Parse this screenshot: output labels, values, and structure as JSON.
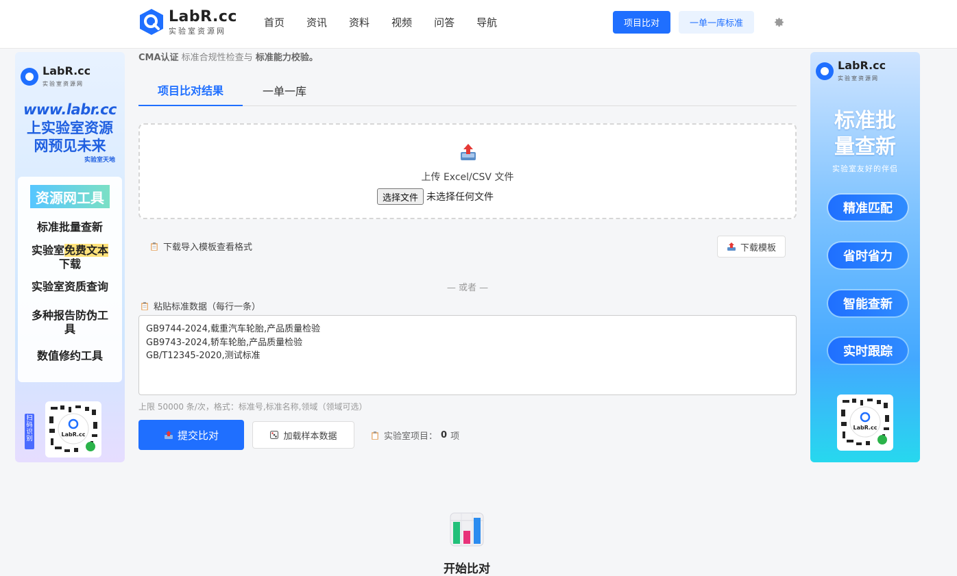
{
  "header": {
    "logo_main": "LabR.cc",
    "logo_sub": "实验室资源网",
    "nav": [
      "首页",
      "资讯",
      "资料",
      "视频",
      "问答",
      "导航"
    ],
    "btn_compare": "项目比对",
    "btn_standard": "一单一库标准"
  },
  "left_ad": {
    "logo_main": "LabR.cc",
    "logo_sub": "实验室资源网",
    "url": "www.labr.cc",
    "slogan_1": "上实验室资源",
    "slogan_2": "网预见未来",
    "tag": "实验室天地",
    "tools_title": "资源网工具",
    "tools": [
      "标准批量查新",
      "实验室",
      "免费文本",
      "下载",
      "实验室资质查询",
      "多种报告防伪工",
      "具",
      "数值修约工具"
    ],
    "scan_tag": "扫码识别",
    "qr_label": "LabR.cc"
  },
  "right_ad": {
    "logo_main": "LabR.cc",
    "logo_sub": "实验室资源网",
    "title_1": "标准批",
    "title_2": "量查新",
    "subtitle": "实验室友好的伴侣",
    "pills": [
      "精准匹配",
      "省时省力",
      "智能查新",
      "实时跟踪"
    ],
    "qr_label": "LabR.cc"
  },
  "main": {
    "crumb_1": "CMA认证",
    "crumb_2": " 标准合规性检查与 ",
    "crumb_3": "标准能力校验。",
    "tabs": [
      "项目比对结果",
      "一单一库"
    ],
    "upload_text": "上传 Excel/CSV 文件",
    "file_button": "选择文件",
    "file_status": "未选择任何文件",
    "template_hint": "下载导入模板查看格式",
    "download_btn": "下载模板",
    "or_divider": "— 或者 —",
    "paste_label": "粘贴标准数据（每行一条）",
    "textarea_value": "GB9744-2024,载重汽车轮胎,产品质量检验\nGB9743-2024,轿车轮胎,产品质量检验\nGB/T12345-2020,测试标准",
    "limit_hint": "上限 50000 条/次，格式：标准号,标准名称,领域（领域可选）",
    "submit_btn": "提交比对",
    "sample_btn": "加载样本数据",
    "count_label": "实验室项目：",
    "count_value": "0",
    "count_unit": "项",
    "empty_title": "开始比对"
  },
  "colors": {
    "primary": "#1f6fff",
    "primary_light": "#eaf3ff"
  }
}
